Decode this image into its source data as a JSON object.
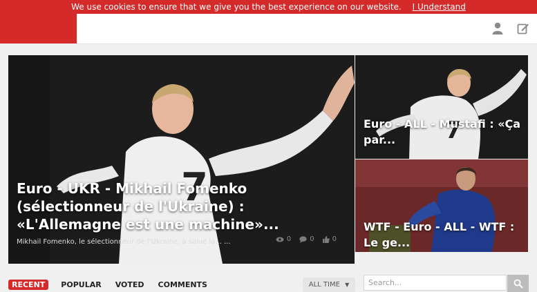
{
  "cookie_bar": {
    "message": "We use cookies to ensure that we give you the best experience on our website.",
    "accept_label": "I Understand"
  },
  "header": {
    "icons": [
      "user-icon",
      "edit-icon"
    ]
  },
  "featured": {
    "main": {
      "title": "Euro - UKR - Mikhail Fomenko (sélectionneur de l'Ukraine) : «L'Allemagne est une machine»...",
      "excerpt": "Mikhail Fomenko, le sélectionneur de l'Ukraine, a salué la... ...",
      "views": "0",
      "comments": "0",
      "likes": "0"
    },
    "side": [
      {
        "title": "Euro - ALL - Mustafi : «Ça par..."
      },
      {
        "title": "WTF - Euro - ALL - WTF : Le ge..."
      }
    ]
  },
  "tabs": [
    "RECENT",
    "POPULAR",
    "VOTED",
    "COMMENTS"
  ],
  "active_tab": "RECENT",
  "time_filter": "ALL TIME",
  "search": {
    "placeholder": "Search..."
  },
  "colors": {
    "brand_red": "#d42a2a",
    "topbar_bg": "#ffffff",
    "page_bg": "#f0f0f0"
  }
}
